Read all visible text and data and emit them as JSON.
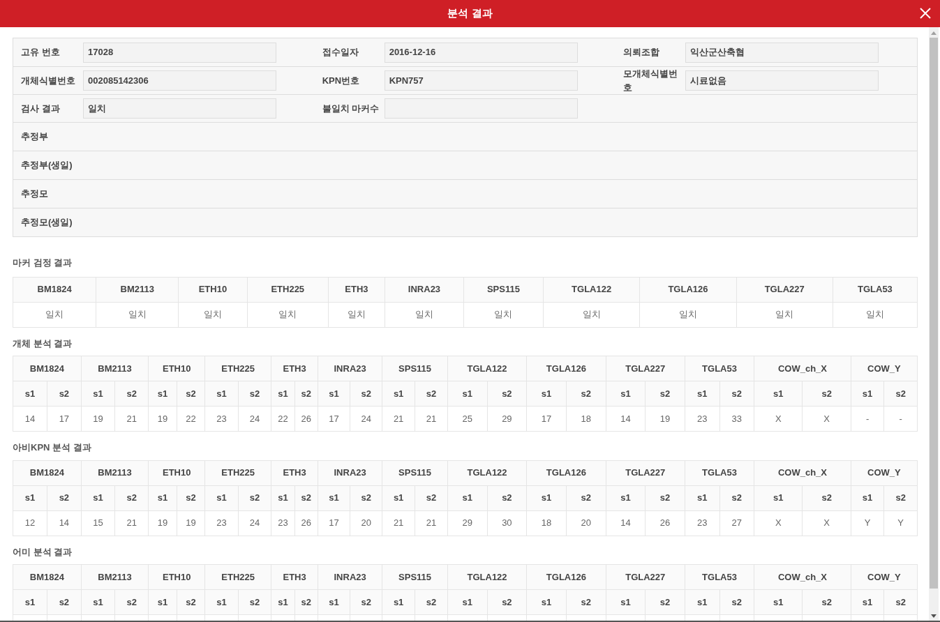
{
  "dialog": {
    "title": "분석 결과"
  },
  "info_rows": [
    {
      "kind": "fields",
      "fields": [
        {
          "label": "고유 번호",
          "value": "17028"
        },
        {
          "label": "접수일자",
          "value": "2016-12-16"
        },
        {
          "label": "의뢰조합",
          "value": "익산군산축협"
        }
      ]
    },
    {
      "kind": "fields",
      "fields": [
        {
          "label": "개체식별번호",
          "value": "002085142306"
        },
        {
          "label": "KPN번호",
          "value": "KPN757"
        },
        {
          "label": "모개체식별번호",
          "value": "시료없음"
        }
      ]
    },
    {
      "kind": "fields",
      "fields": [
        {
          "label": "검사 결과",
          "value": "일치"
        },
        {
          "label": "불일치 마커수"
        }
      ]
    },
    {
      "kind": "label",
      "label": "추정부"
    },
    {
      "kind": "label",
      "label": "추정부(생일)"
    },
    {
      "kind": "label",
      "label": "추정모"
    },
    {
      "kind": "label",
      "label": "추정모(생일)"
    }
  ],
  "marker_check": {
    "title": "마커 검정 결과",
    "columns": [
      "BM1824",
      "BM2113",
      "ETH10",
      "ETH225",
      "ETH3",
      "INRA23",
      "SPS115",
      "TGLA122",
      "TGLA126",
      "TGLA227",
      "TGLA53"
    ],
    "values": [
      "일치",
      "일치",
      "일치",
      "일치",
      "일치",
      "일치",
      "일치",
      "일치",
      "일치",
      "일치",
      "일치"
    ]
  },
  "analyses": [
    {
      "title": "개체 분석 결과",
      "markers": [
        {
          "name": "BM1824",
          "sub": [
            "s1",
            "s2"
          ],
          "values": [
            "14",
            "17"
          ]
        },
        {
          "name": "BM2113",
          "sub": [
            "s1",
            "s2"
          ],
          "values": [
            "19",
            "21"
          ]
        },
        {
          "name": "ETH10",
          "sub": [
            "s1",
            "s2"
          ],
          "values": [
            "19",
            "22"
          ]
        },
        {
          "name": "ETH225",
          "sub": [
            "s1",
            "s2"
          ],
          "values": [
            "23",
            "24"
          ]
        },
        {
          "name": "ETH3",
          "sub": [
            "s1",
            "s2"
          ],
          "values": [
            "22",
            "26"
          ]
        },
        {
          "name": "INRA23",
          "sub": [
            "s1",
            "s2"
          ],
          "values": [
            "17",
            "24"
          ]
        },
        {
          "name": "SPS115",
          "sub": [
            "s1",
            "s2"
          ],
          "values": [
            "21",
            "21"
          ]
        },
        {
          "name": "TGLA122",
          "sub": [
            "s1",
            "s2"
          ],
          "values": [
            "25",
            "29"
          ]
        },
        {
          "name": "TGLA126",
          "sub": [
            "s1",
            "s2"
          ],
          "values": [
            "17",
            "18"
          ]
        },
        {
          "name": "TGLA227",
          "sub": [
            "s1",
            "s2"
          ],
          "values": [
            "14",
            "19"
          ]
        },
        {
          "name": "TGLA53",
          "sub": [
            "s1",
            "s2"
          ],
          "values": [
            "23",
            "33"
          ]
        },
        {
          "name": "COW_ch_X",
          "sub": [
            "s1",
            "s2"
          ],
          "values": [
            "X",
            "X"
          ]
        },
        {
          "name": "COW_Y",
          "sub": [
            "s1",
            "s2"
          ],
          "values": [
            "-",
            "-"
          ]
        }
      ]
    },
    {
      "title": "아비KPN 분석 결과",
      "markers": [
        {
          "name": "BM1824",
          "sub": [
            "s1",
            "s2"
          ],
          "values": [
            "12",
            "14"
          ]
        },
        {
          "name": "BM2113",
          "sub": [
            "s1",
            "s2"
          ],
          "values": [
            "15",
            "21"
          ]
        },
        {
          "name": "ETH10",
          "sub": [
            "s1",
            "s2"
          ],
          "values": [
            "19",
            "19"
          ]
        },
        {
          "name": "ETH225",
          "sub": [
            "s1",
            "s2"
          ],
          "values": [
            "23",
            "24"
          ]
        },
        {
          "name": "ETH3",
          "sub": [
            "s1",
            "s2"
          ],
          "values": [
            "23",
            "26"
          ]
        },
        {
          "name": "INRA23",
          "sub": [
            "s1",
            "s2"
          ],
          "values": [
            "17",
            "20"
          ]
        },
        {
          "name": "SPS115",
          "sub": [
            "s1",
            "s2"
          ],
          "values": [
            "21",
            "21"
          ]
        },
        {
          "name": "TGLA122",
          "sub": [
            "s1",
            "s2"
          ],
          "values": [
            "29",
            "30"
          ]
        },
        {
          "name": "TGLA126",
          "sub": [
            "s1",
            "s2"
          ],
          "values": [
            "18",
            "20"
          ]
        },
        {
          "name": "TGLA227",
          "sub": [
            "s1",
            "s2"
          ],
          "values": [
            "14",
            "26"
          ]
        },
        {
          "name": "TGLA53",
          "sub": [
            "s1",
            "s2"
          ],
          "values": [
            "23",
            "27"
          ]
        },
        {
          "name": "COW_ch_X",
          "sub": [
            "s1",
            "s2"
          ],
          "values": [
            "X",
            "X"
          ]
        },
        {
          "name": "COW_Y",
          "sub": [
            "s1",
            "s2"
          ],
          "values": [
            "Y",
            "Y"
          ]
        }
      ]
    },
    {
      "title": "어미 분석 결과",
      "markers": [
        {
          "name": "BM1824",
          "sub": [
            "s1",
            "s2"
          ]
        },
        {
          "name": "BM2113",
          "sub": [
            "s1",
            "s2"
          ]
        },
        {
          "name": "ETH10",
          "sub": [
            "s1",
            "s2"
          ]
        },
        {
          "name": "ETH225",
          "sub": [
            "s1",
            "s2"
          ]
        },
        {
          "name": "ETH3",
          "sub": [
            "s1",
            "s2"
          ]
        },
        {
          "name": "INRA23",
          "sub": [
            "s1",
            "s2"
          ]
        },
        {
          "name": "SPS115",
          "sub": [
            "s1",
            "s2"
          ]
        },
        {
          "name": "TGLA122",
          "sub": [
            "s1",
            "s2"
          ]
        },
        {
          "name": "TGLA126",
          "sub": [
            "s1",
            "s2"
          ]
        },
        {
          "name": "TGLA227",
          "sub": [
            "s1",
            "s2"
          ]
        },
        {
          "name": "TGLA53",
          "sub": [
            "s1",
            "s2"
          ]
        },
        {
          "name": "COW_ch_X",
          "sub": [
            "s1",
            "s2"
          ]
        },
        {
          "name": "COW_Y",
          "sub": [
            "s1",
            "s2"
          ]
        }
      ]
    }
  ]
}
